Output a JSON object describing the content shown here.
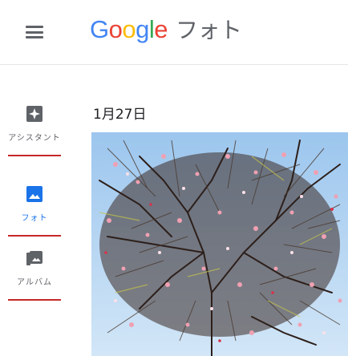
{
  "header": {
    "logo_letters": [
      {
        "ch": "G",
        "color": "#4285F4"
      },
      {
        "ch": "o",
        "color": "#EA4335"
      },
      {
        "ch": "o",
        "color": "#FBBC05"
      },
      {
        "ch": "g",
        "color": "#4285F4"
      },
      {
        "ch": "l",
        "color": "#34A853"
      },
      {
        "ch": "e",
        "color": "#EA4335"
      }
    ],
    "product_name": "フォト",
    "menu_icon": "hamburger-menu-icon"
  },
  "sidebar": {
    "items": [
      {
        "label": "アシスタント",
        "icon": "assistant-icon",
        "active": false
      },
      {
        "label": "フォト",
        "icon": "photo-icon",
        "active": true
      },
      {
        "label": "アルバム",
        "icon": "album-icon",
        "active": false
      }
    ]
  },
  "main": {
    "date": "1月27日",
    "photo": {
      "subject": "plum-blossom-photo"
    }
  },
  "colors": {
    "accent": "#1a73e8",
    "underline": "#c62828",
    "icon_gray": "#5f6368",
    "sky": "#b9d7f3"
  }
}
